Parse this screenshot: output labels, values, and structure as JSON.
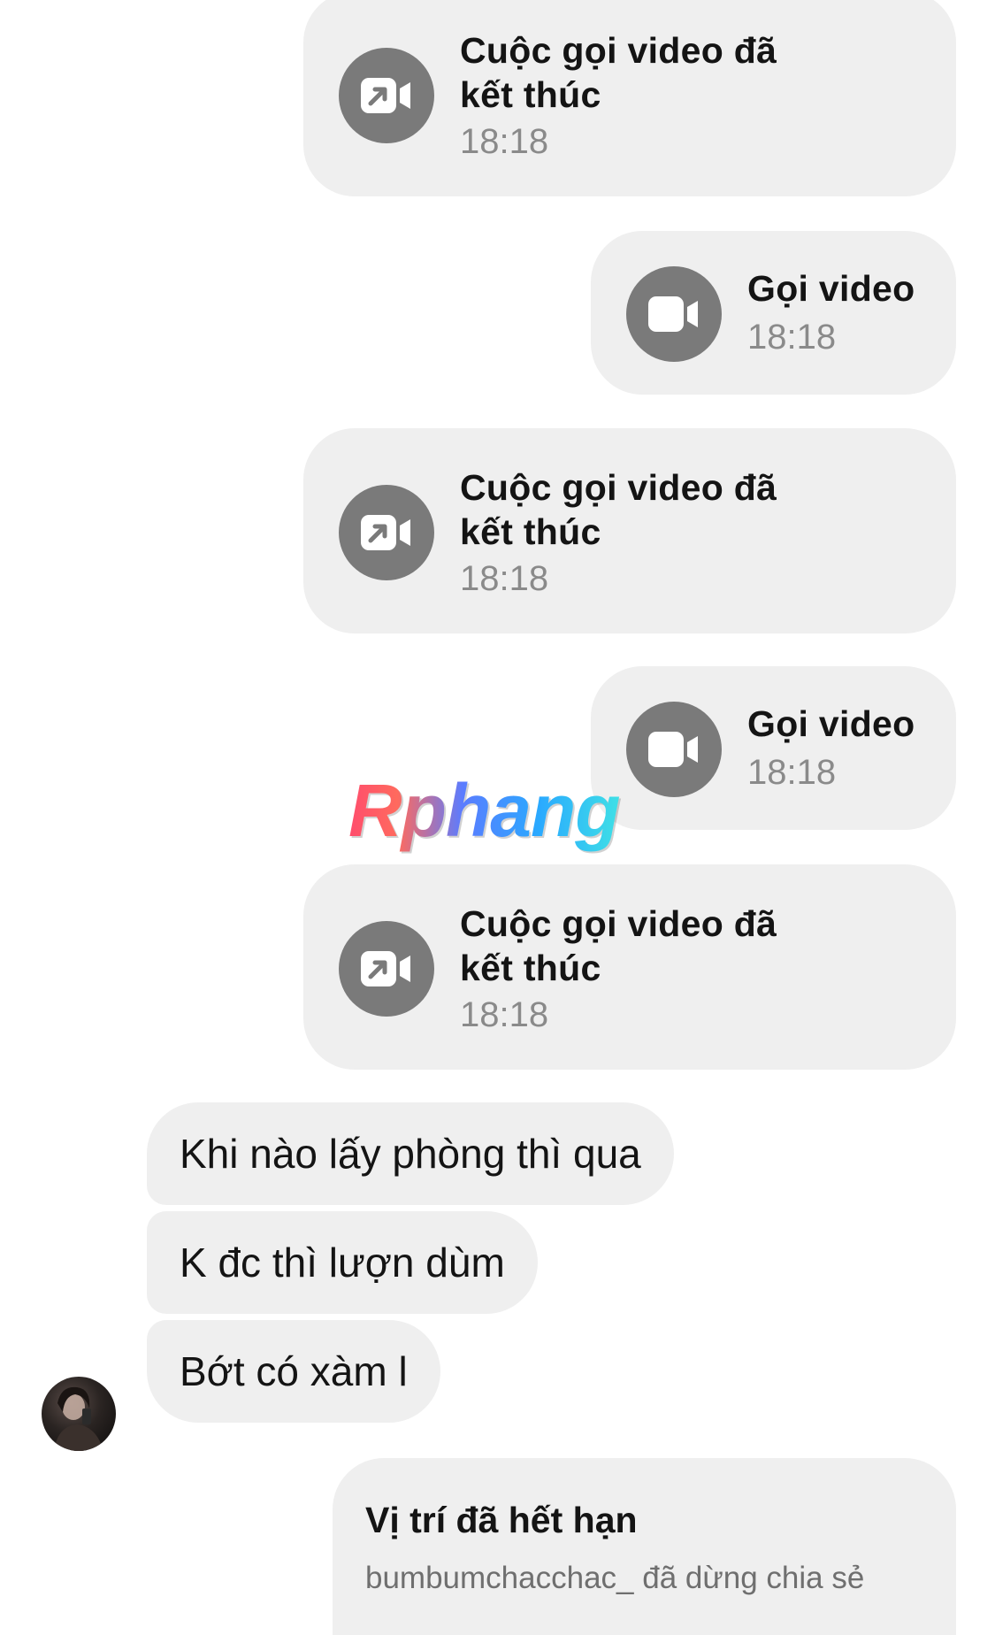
{
  "messages": {
    "call_ended_1": {
      "title": "Cuộc gọi video đã kết thúc",
      "time": "18:18",
      "icon": "video-call-ended-icon"
    },
    "video_call_1": {
      "title": "Gọi video",
      "time": "18:18",
      "icon": "video-camera-icon"
    },
    "call_ended_2": {
      "title": "Cuộc gọi video đã kết thúc",
      "time": "18:18",
      "icon": "video-call-ended-icon"
    },
    "video_call_2": {
      "title": "Gọi video",
      "time": "18:18",
      "icon": "video-camera-icon"
    },
    "call_ended_3": {
      "title": "Cuộc gọi video đã kết thúc",
      "time": "18:18",
      "icon": "video-call-ended-icon"
    },
    "incoming": [
      {
        "text": "Khi nào lấy phòng thì qua"
      },
      {
        "text": "K đc thì lượn dùm"
      },
      {
        "text": "Bớt có xàm l"
      }
    ],
    "location": {
      "title": "Vị trí đã hết hạn",
      "subtitle": "bumbumchacchac_ đã dừng chia sẻ"
    }
  },
  "watermark": "Rphang",
  "colors": {
    "bubble": "#efefef",
    "icon_circle": "#7a7a7a",
    "time_text": "#8a8a8a",
    "page_bg": "#ffffff"
  }
}
